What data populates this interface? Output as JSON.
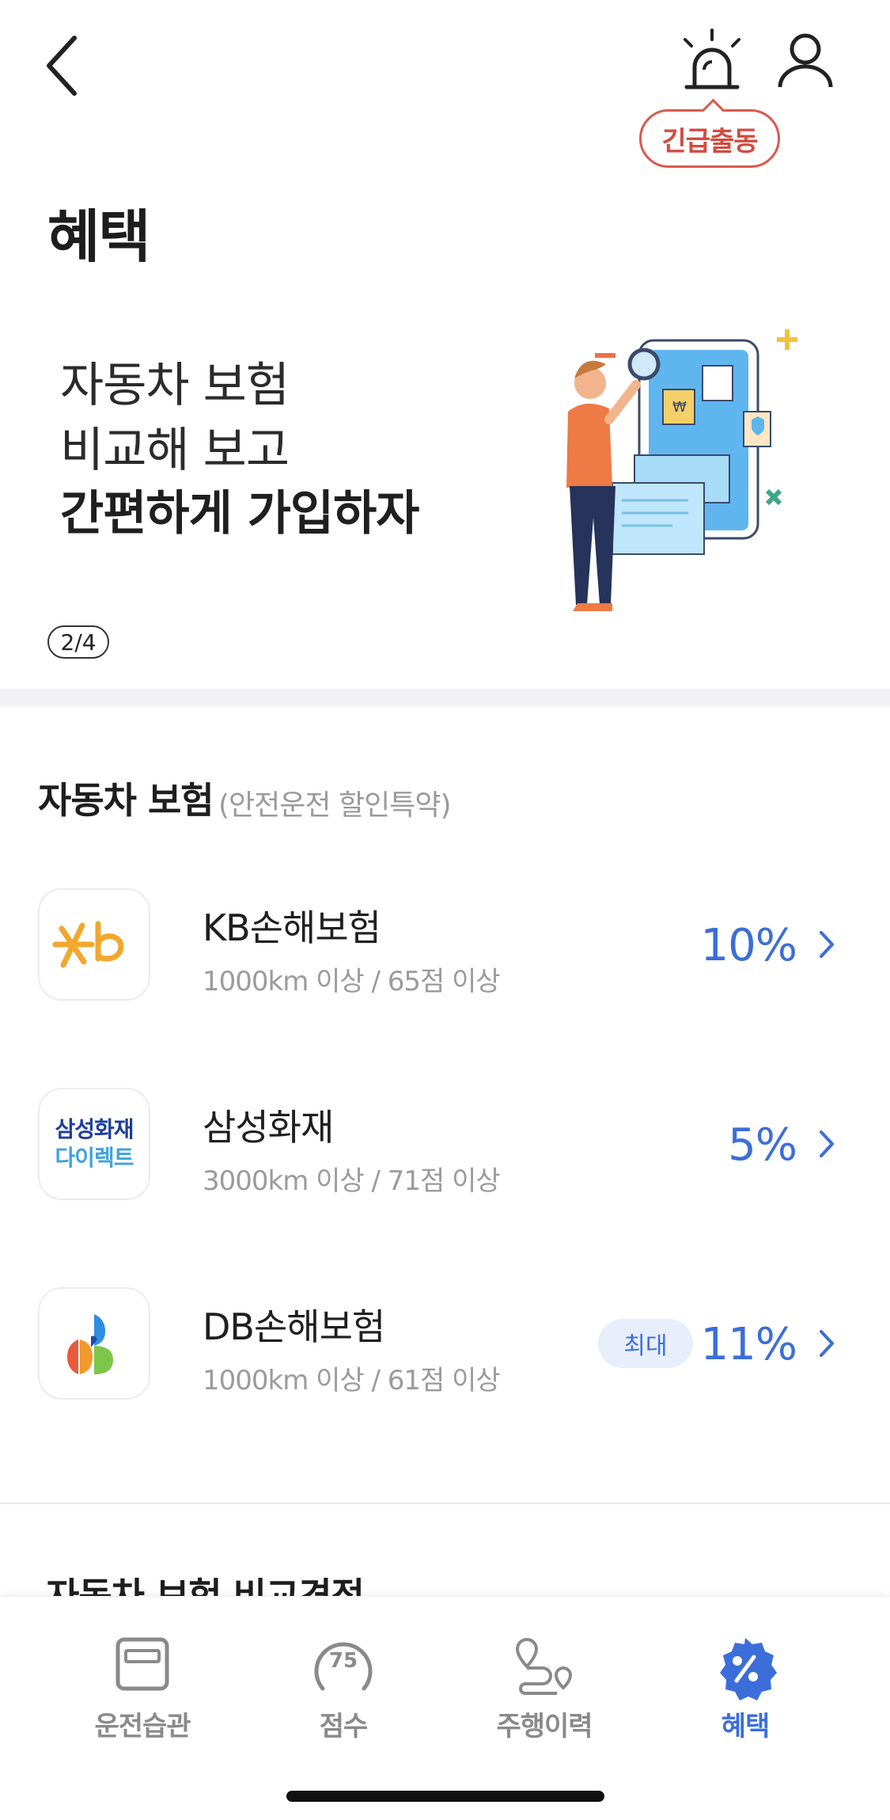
{
  "header": {
    "emergency_label": "긴급출동",
    "title": "혜택"
  },
  "banner": {
    "line1": "자동차 보험",
    "line2": "비교해 보고",
    "line3": "간편하게 가입하자",
    "page_indicator": "2/4"
  },
  "section": {
    "title": "자동차 보험",
    "subtitle": "(안전운전 할인특약)"
  },
  "insurers": [
    {
      "name": "KB손해보험",
      "condition": "1000km 이상 / 65점 이상",
      "rate": "10%",
      "logo": "kb-logo"
    },
    {
      "name": "삼성화재",
      "condition": "3000km 이상 / 71점 이상",
      "rate": "5%",
      "logo": "samsung-logo",
      "logo_text1": "삼성화재",
      "logo_text2": "다이렉트"
    },
    {
      "name": "DB손해보험",
      "condition": "1000km 이상 / 61점 이상",
      "rate": "11%",
      "badge": "최대",
      "logo": "db-logo"
    }
  ],
  "next_section": {
    "title": "자동차 보험 비교견적"
  },
  "nav": {
    "items": [
      {
        "label": "운전습관",
        "icon": "card-icon"
      },
      {
        "label": "점수",
        "icon": "gauge-icon",
        "icon_text": "75"
      },
      {
        "label": "주행이력",
        "icon": "route-icon"
      },
      {
        "label": "혜택",
        "icon": "percent-badge-icon"
      }
    ],
    "active": "혜택"
  },
  "colors": {
    "accent": "#3b6ed9",
    "emergency": "#d24b40"
  }
}
